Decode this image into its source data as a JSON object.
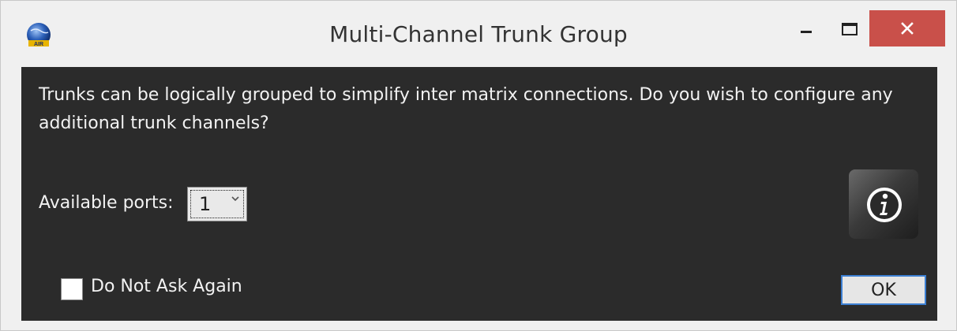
{
  "window": {
    "title": "Multi-Channel Trunk Group",
    "icon": "app-globe-icon"
  },
  "controls": {
    "minimize_icon": "minimize-icon",
    "maximize_icon": "maximize-icon",
    "close_icon": "close-icon",
    "close_color": "#c9504a"
  },
  "dialog": {
    "message": "Trunks can be logically grouped to simplify inter matrix connections. Do you wish to configure any additional trunk channels?",
    "ports_label": "Available ports:",
    "ports_value": "1",
    "info_icon": "info-icon",
    "checkbox_label": "Do Not Ask Again",
    "checkbox_checked": false,
    "ok_label": "OK"
  },
  "colors": {
    "dialog_background": "#2b2b2b",
    "focus_border": "#3c7fd2"
  }
}
